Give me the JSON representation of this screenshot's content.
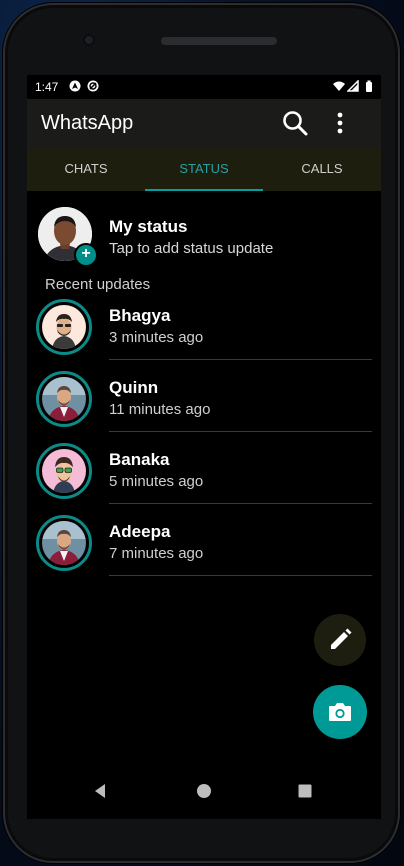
{
  "status_bar": {
    "time": "1:47"
  },
  "app": {
    "title": "WhatsApp"
  },
  "tabs": [
    {
      "label": "CHATS"
    },
    {
      "label": "STATUS"
    },
    {
      "label": "CALLS"
    }
  ],
  "my_status": {
    "name": "My status",
    "subtitle": "Tap to add status update",
    "add_symbol": "+"
  },
  "recent_header": "Recent updates",
  "updates": [
    {
      "name": "Bhagya",
      "time": "3 minutes ago"
    },
    {
      "name": "Quinn",
      "time": "11 minutes ago"
    },
    {
      "name": "Banaka",
      "time": "5 minutes ago"
    },
    {
      "name": "Adeepa",
      "time": "7 minutes ago"
    }
  ],
  "colors": {
    "accent": "#00a0a0",
    "appbar": "#1b1c19",
    "tabbar": "#1e1e0f",
    "fab_camera": "#009a96",
    "fab_edit": "#1e1e10",
    "background": "#000000"
  },
  "icons": [
    "search-icon",
    "more-vert-icon",
    "pencil-icon",
    "camera-icon",
    "back-icon",
    "home-icon",
    "recents-icon",
    "wifi-icon",
    "signal-icon",
    "battery-icon"
  ]
}
